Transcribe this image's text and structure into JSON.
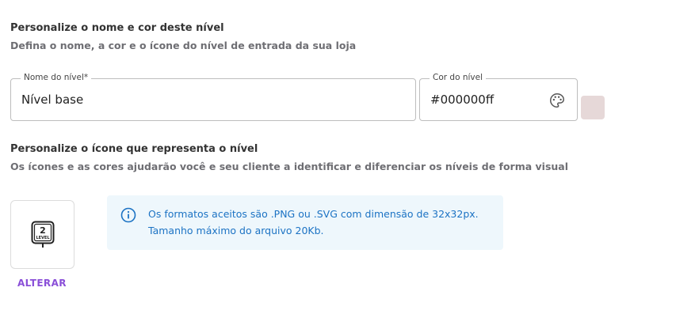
{
  "name_section": {
    "title": "Personalize o nome e cor deste nível",
    "subtitle": "Defina o nome, a cor e o ícone do nível de entrada da sua loja"
  },
  "name_field": {
    "label": "Nome do nível*",
    "value": "Nível base"
  },
  "color_field": {
    "label": "Cor do nível",
    "value": "#000000ff",
    "icon": "palette-icon"
  },
  "swatch_color": "#e6d8d8",
  "icon_section": {
    "title": "Personalize o ícone que representa o nível",
    "subtitle": "Os ícones e as cores ajudarão você e seu cliente a identificar e diferenciar os níveis de forma visual"
  },
  "level_icon": {
    "number": "2",
    "label": "LEVEL",
    "icon": "level-badge-icon"
  },
  "change_button": {
    "label": "ALTERAR"
  },
  "info": {
    "icon": "info-icon",
    "line1": "Os formatos aceitos são .PNG ou .SVG com dimensão de 32x32px.",
    "line2": "Tamanho máximo do arquivo 20Kb."
  },
  "colors": {
    "accent": "#8a4fd8",
    "info_text": "#1c73c4",
    "info_bg": "#eef7fc"
  }
}
